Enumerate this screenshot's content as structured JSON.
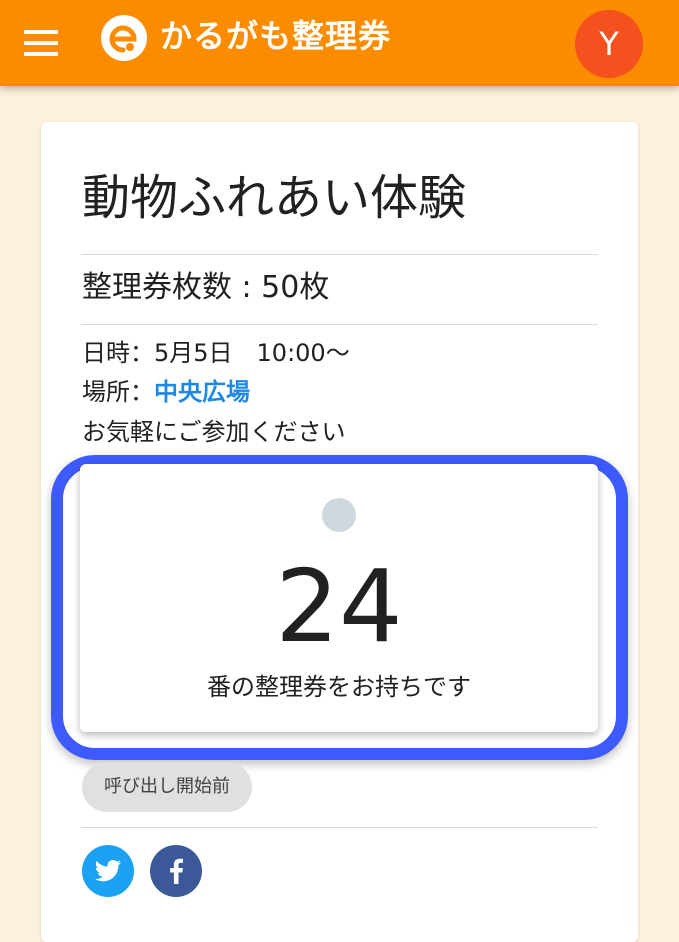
{
  "header": {
    "title": "かるがも整理券",
    "avatar_letter": "Y",
    "color": "#fb8c00",
    "avatar_color": "#f4511e",
    "menu_icon": "menu-icon",
    "logo_icon": "logo-icon"
  },
  "event": {
    "title": "動物ふれあい体験",
    "ticket_count": "整理券枚数 : 50枚",
    "datetime_label": "日時：5月5日　10:00～",
    "place_label": "場所：",
    "place_value": "中央広場",
    "note": "お気軽にご参加ください"
  },
  "ticket": {
    "number": "24",
    "caption": "番の整理券をお持ちです",
    "status_chip": "呼び出し開始前",
    "status_dot_color": "#cfd8dc",
    "highlight_color": "#3d5afe"
  },
  "share": {
    "twitter_icon": "twitter-icon",
    "facebook_icon": "facebook-icon",
    "twitter_color": "#1da1f2",
    "facebook_color": "#3b5998"
  }
}
